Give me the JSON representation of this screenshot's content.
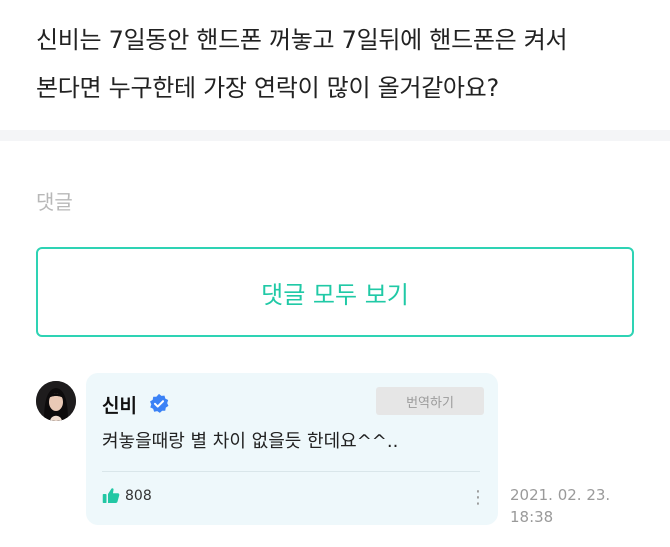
{
  "question": {
    "line1": "신비는 7일동안 핸드폰 꺼놓고 7일뒤에 핸드폰은 켜서",
    "line2": "본다면 누구한테 가장 연락이 많이 올거같아요?"
  },
  "comments_section": {
    "label": "댓글",
    "view_all_label": "댓글 모두 보기"
  },
  "comment": {
    "author": "신비",
    "translate_label": "번역하기",
    "text": "켜놓을때랑 별 차이 없을듯 한데요^^..",
    "likes": "808",
    "date_line1": "2021. 02. 23.",
    "date_line2": "18:38",
    "more_icon": "⋮"
  },
  "colors": {
    "accent": "#20c9a6",
    "verified": "#3b82f6",
    "bubble_bg": "#eef8fb",
    "like_green": "#22c7a4"
  }
}
